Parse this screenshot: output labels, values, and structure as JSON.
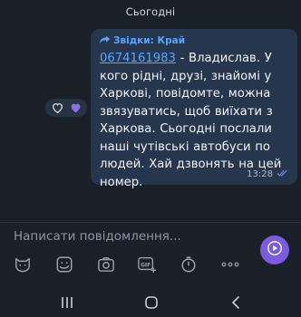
{
  "header": {
    "date": "Сьогодні"
  },
  "message": {
    "forwarded_label": "Звідки: Край",
    "phone": "0674161983",
    "text_after_phone": " - Владислав. У кого рідні, друзі, знайомі у Харкові, повідомте, можна звязуватись, щоб виїхати з Харкова. Сьогодні послали наші чутівські автобуси по людей. Хай дзвонять на цей номер.",
    "time": "13:28",
    "status_icon": "double-check-icon"
  },
  "reactions": [
    {
      "icon": "heart-outline-icon"
    },
    {
      "icon": "heart-filled-icon"
    }
  ],
  "composer": {
    "placeholder": "Написати повідомлення...",
    "tools": [
      "sticker-cat-icon",
      "sticker-icon",
      "camera-icon",
      "gif-icon",
      "timer-icon",
      "more-icon"
    ],
    "gif_label": "GIF"
  },
  "colors": {
    "background": "#1a2028",
    "bubble": "#26374d",
    "accent": "#7b5ce0",
    "link": "#57a6ff"
  }
}
